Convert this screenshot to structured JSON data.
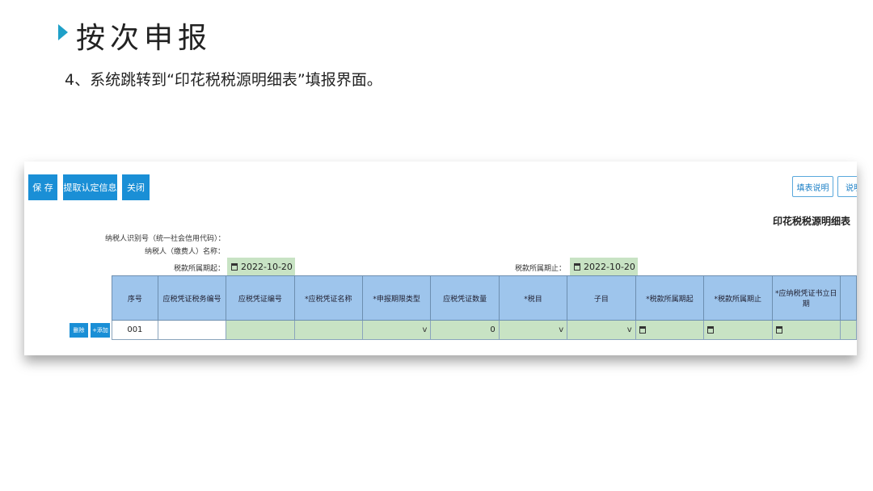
{
  "slide": {
    "title": "按次申报",
    "step": "4、系统跳转到“印花税税源明细表”填报界面。"
  },
  "toolbar": {
    "save_label": "保 存",
    "fetch_label": "提取认定信息",
    "close_label": "关闭",
    "guide_label": "填表说明",
    "guide2_label": "说明"
  },
  "form": {
    "title": "印花税税源明细表",
    "taxpayer_id_label": "纳税人识别号（统一社会信用代码）：",
    "taxpayer_name_label": "纳税人（缴费人）名称：",
    "period_start_label": "税款所属期起：",
    "period_start_value": "2022-10-20",
    "period_end_label": "税款所属期止：",
    "period_end_value": "2022-10-20"
  },
  "table": {
    "headers": [
      "序号",
      "应税凭证税务编号",
      "应税凭证编号",
      "*应税凭证名称",
      "*申报期限类型",
      "应税凭证数量",
      "*税目",
      "子目",
      "*税款所属期起",
      "*税款所属期止",
      "*应纳税凭证书立日期"
    ],
    "row": {
      "seq": "001",
      "quantity": "0",
      "chevron": "v"
    }
  },
  "row_actions": {
    "delete_label": "删除",
    "add_label": "+添加"
  }
}
